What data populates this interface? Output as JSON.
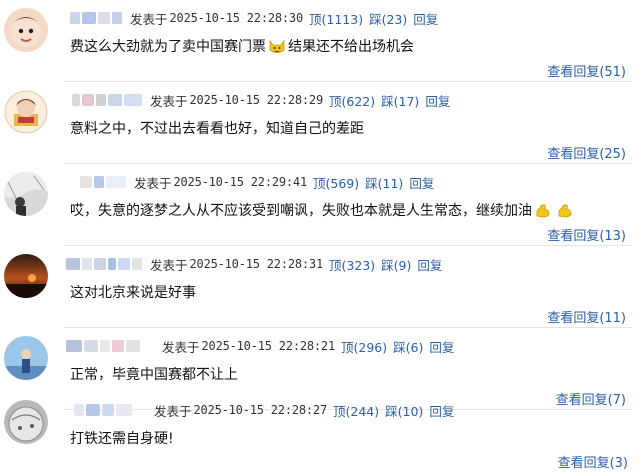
{
  "comments": [
    {
      "posted_prefix": "发表于",
      "timestamp": "2025-10-15 22:28:30",
      "like_label": "顶",
      "likes": "(1113)",
      "dislike_label": "踩",
      "dislikes": "(23)",
      "reply_label": "回复",
      "text_before": "费这么大劲就为了卖中国赛门票",
      "emoji": "cat-face-emoji",
      "text_after": "结果还不给出场机会",
      "view_replies": "查看回复(51)"
    },
    {
      "posted_prefix": "发表于",
      "timestamp": "2025-10-15 22:28:29",
      "like_label": "顶",
      "likes": "(622)",
      "dislike_label": "踩",
      "dislikes": "(17)",
      "reply_label": "回复",
      "text_before": "意料之中，不过出去看看也好，知道自己的差距",
      "text_after": "",
      "view_replies": "查看回复(25)"
    },
    {
      "posted_prefix": "发表于",
      "timestamp": "2025-10-15 22:29:41",
      "like_label": "顶",
      "likes": "(569)",
      "dislike_label": "踩",
      "dislikes": "(11)",
      "reply_label": "回复",
      "text_before": "哎，失意的逐梦之人从不应该受到嘲讽，失败也本就是人生常态，继续加油",
      "emoji": "flexed-biceps-emoji",
      "text_after": "",
      "view_replies": "查看回复(13)"
    },
    {
      "posted_prefix": "发表于",
      "timestamp": "2025-10-15 22:28:31",
      "like_label": "顶",
      "likes": "(323)",
      "dislike_label": "踩",
      "dislikes": "(9)",
      "reply_label": "回复",
      "text_before": "这对北京来说是好事",
      "text_after": "",
      "view_replies": "查看回复(11)"
    },
    {
      "posted_prefix": "发表于",
      "timestamp": "2025-10-15 22:28:21",
      "like_label": "顶",
      "likes": "(296)",
      "dislike_label": "踩",
      "dislikes": "(6)",
      "reply_label": "回复",
      "text_before": "正常，毕竟中国赛都不让上",
      "text_after": "",
      "view_replies": "查看回复(7)"
    },
    {
      "posted_prefix": "发表于",
      "timestamp": "2025-10-15 22:28:27",
      "like_label": "顶",
      "likes": "(244)",
      "dislike_label": "踩",
      "dislikes": "(10)",
      "reply_label": "回复",
      "text_before": "打铁还需自身硬!",
      "text_after": "",
      "view_replies": "查看回复(3)"
    }
  ],
  "colors": {
    "link": "#2b5fa6",
    "text": "#111111",
    "divider": "#e6e6e6",
    "emoji_yellow": "#f5c518"
  }
}
